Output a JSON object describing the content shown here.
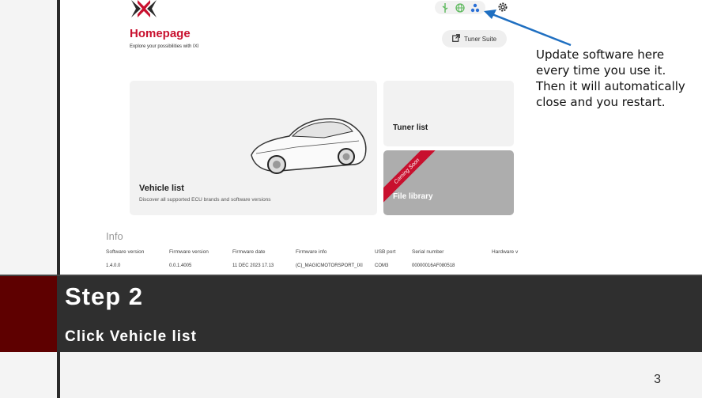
{
  "app": {
    "title": "Homepage",
    "subtitle": "Explore your possibilities with IXI",
    "tuner_button_label": "Tuner Suite",
    "status_icons": [
      "usb-icon",
      "globe-icon",
      "update-icon"
    ],
    "settings_icon": "gear-icon",
    "colors": {
      "brand": "#c8102e",
      "card": "#f2f2f2",
      "card_disabled": "#adadad"
    }
  },
  "cards": {
    "vehicle": {
      "title": "Vehicle list",
      "description": "Discover all supported ECU brands and software versions"
    },
    "tuner": {
      "title": "Tuner list"
    },
    "file_library": {
      "title": "File library",
      "ribbon": "Coming Soon"
    }
  },
  "info": {
    "title": "Info",
    "headers": [
      "Software version",
      "Firmware version",
      "Firmware date",
      "Firmware info",
      "USB port",
      "Serial number",
      "Hardware v"
    ],
    "values": [
      "1.4.0.0",
      "0.0.1.4005",
      "11 DEC 2023 17.13",
      "(C)_MAGICMOTORSPORT_IXI",
      "COM3",
      "00000016AF080518",
      ""
    ]
  },
  "annotation": {
    "text": "Update software here every time you use it. Then it will automatically close and you restart."
  },
  "banner": {
    "step": "Step 2",
    "instruction": "Click Vehicle list"
  },
  "slide": {
    "page_number": "3"
  }
}
